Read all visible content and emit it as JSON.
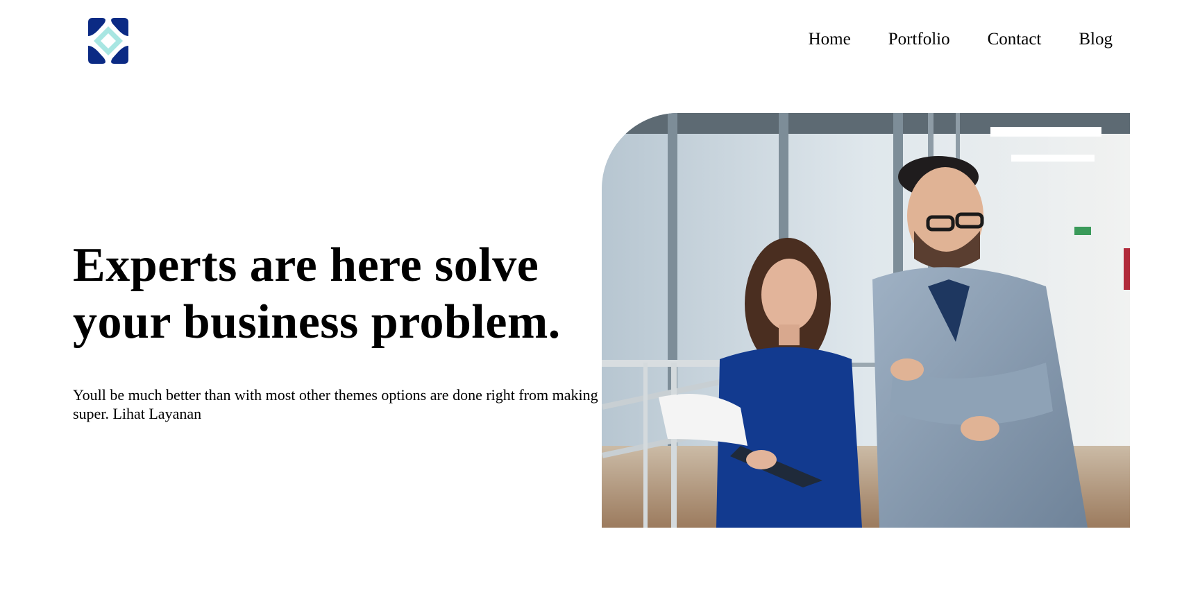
{
  "brand": {
    "logo_icon": "four-point-star-logo-icon",
    "colors": {
      "primary": "#0b2a84",
      "accent": "#a8e6e2"
    }
  },
  "nav": {
    "items": [
      {
        "label": "Home"
      },
      {
        "label": "Portfolio"
      },
      {
        "label": "Contact"
      },
      {
        "label": "Blog"
      }
    ]
  },
  "hero": {
    "title": "Experts are here solve your business problem.",
    "description": "Youll be much better than with most other themes options are done right from making super. Lihat Layanan",
    "image": "business-people-office-photo"
  }
}
